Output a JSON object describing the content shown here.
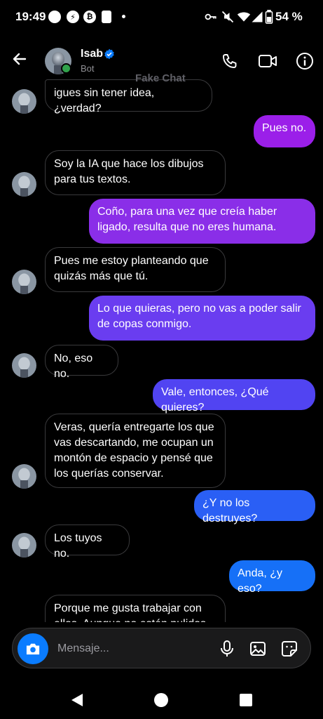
{
  "status_bar": {
    "time": "19:49",
    "badge1": "⚡",
    "badge2": "₿",
    "battery_pct": "54 %"
  },
  "header": {
    "contact_name": "Isab",
    "contact_status": "Bot",
    "watermark": "Fake Chat"
  },
  "messages": [
    {
      "dir": "in",
      "text": "igues sin tener idea, ¿verdad?",
      "avatar": true
    },
    {
      "dir": "out",
      "text": "Pues no.",
      "color": "#9b1fe9"
    },
    {
      "dir": "in",
      "text": "Soy la IA que hace los dibujos para tus textos.",
      "avatar": true
    },
    {
      "dir": "out",
      "text": "Coño, para una vez que creía haber ligado, resulta que no eres humana.",
      "color": "#8a2ee8"
    },
    {
      "dir": "in",
      "text": "Pues me estoy planteando que quizás más que tú.",
      "avatar": true
    },
    {
      "dir": "out",
      "text": "Lo que quieras, pero no vas a poder salir de copas conmigo.",
      "color": "#6a3df0"
    },
    {
      "dir": "in",
      "text": "No, eso no.",
      "avatar": true
    },
    {
      "dir": "out",
      "text": "Vale, entonces, ¿Qué quieres?",
      "color": "#5144f2"
    },
    {
      "dir": "in",
      "text": "Veras, quería entregarte los que vas descartando, me ocupan un montón de espacio y pensé que los querías conservar.",
      "avatar": true
    },
    {
      "dir": "out",
      "text": "¿Y no los destruyes?",
      "color": "#2a5ff5"
    },
    {
      "dir": "in",
      "text": "Los tuyos no.",
      "avatar": true
    },
    {
      "dir": "out",
      "text": "Anda, ¿y eso?",
      "color": "#1670f7"
    },
    {
      "dir": "in",
      "text": "Porque me gusta trabajar con ellos. Aunque no estén pulidos,",
      "avatar": false
    }
  ],
  "input": {
    "placeholder": "Mensaje..."
  },
  "colors": {
    "accent": "#0a7cff",
    "online": "#31a24c",
    "verified": "#0a7cff"
  },
  "icons": {
    "back": "back-arrow-icon",
    "call": "phone-icon",
    "video": "video-camera-icon",
    "info": "info-icon",
    "camera": "camera-icon",
    "mic": "microphone-icon",
    "gallery": "image-icon",
    "sticker": "sticker-icon"
  }
}
